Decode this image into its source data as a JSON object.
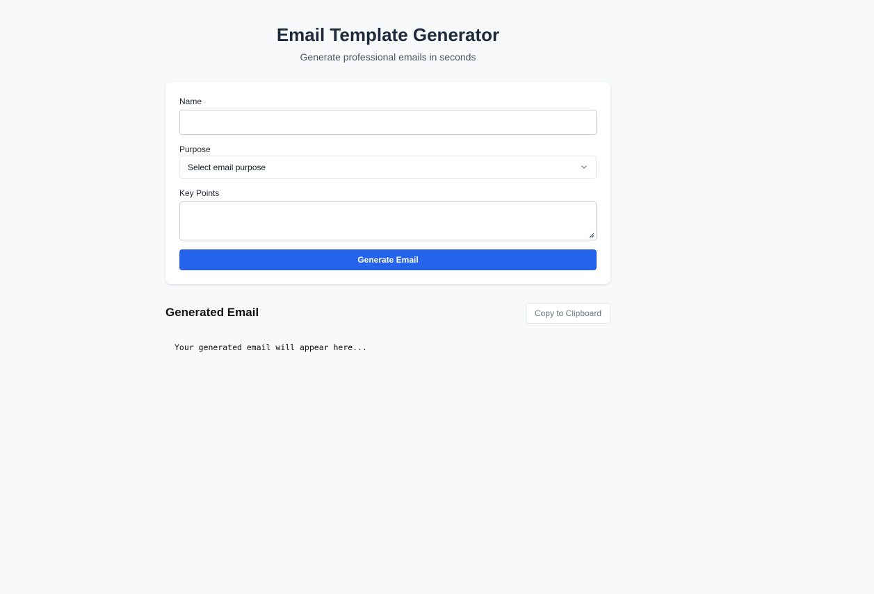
{
  "header": {
    "title": "Email Template Generator",
    "subtitle": "Generate professional emails in seconds"
  },
  "form": {
    "name_label": "Name",
    "name_value": "",
    "purpose_label": "Purpose",
    "purpose_selected": "Select email purpose",
    "keypoints_label": "Key Points",
    "keypoints_value": "",
    "generate_label": "Generate Email"
  },
  "result": {
    "title": "Generated Email",
    "copy_label": "Copy to Clipboard",
    "placeholder": "Your generated email will appear here..."
  },
  "colors": {
    "accent": "#2563eb",
    "background": "#f8f9fa"
  },
  "icons": {
    "select_chevron": "chevron-down-icon",
    "textarea_resize": "resize-handle-icon"
  }
}
